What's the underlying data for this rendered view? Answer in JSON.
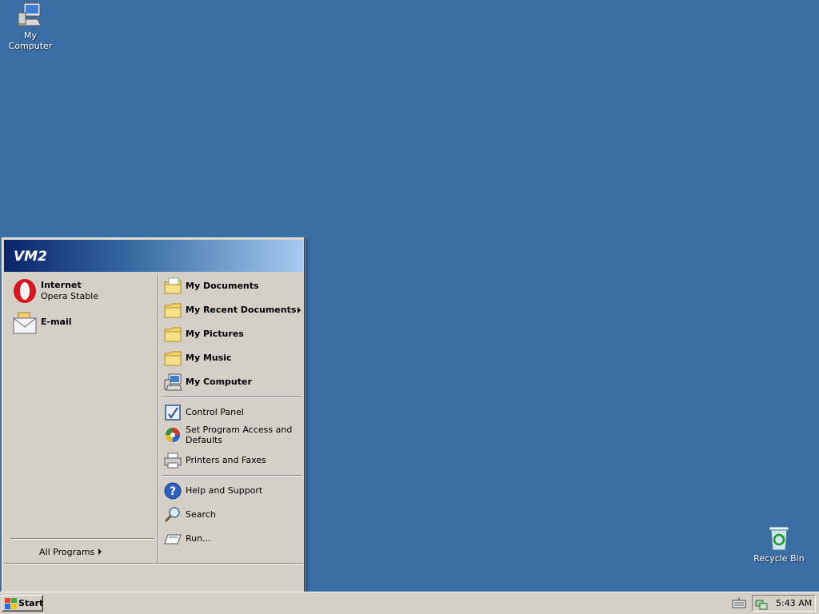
{
  "desktop": {
    "icons": [
      {
        "label": "My Computer"
      },
      {
        "label": "Recycle Bin"
      }
    ]
  },
  "start_menu": {
    "user_name": "VM2",
    "pinned": [
      {
        "title": "Internet",
        "subtitle": "Opera Stable",
        "icon": "opera-icon"
      },
      {
        "title": "E-mail",
        "icon": "email-icon"
      }
    ],
    "all_programs_label": "All Programs",
    "right_items": [
      {
        "label": "My Documents",
        "icon": "folder-documents-icon"
      },
      {
        "label": "My Recent Documents",
        "icon": "folder-icon",
        "has_submenu": true
      },
      {
        "label": "My Pictures",
        "icon": "folder-icon"
      },
      {
        "label": "My Music",
        "icon": "folder-icon"
      },
      {
        "label": "My Computer",
        "icon": "computer-icon"
      },
      {
        "label": "Control Panel",
        "icon": "control-panel-icon"
      },
      {
        "label": "Set Program Access and Defaults",
        "icon": "program-access-icon"
      },
      {
        "label": "Printers and Faxes",
        "icon": "printer-icon"
      },
      {
        "label": "Help and Support",
        "icon": "help-icon"
      },
      {
        "label": "Search",
        "icon": "search-icon"
      },
      {
        "label": "Run...",
        "icon": "run-icon"
      }
    ]
  },
  "taskbar": {
    "start_label": "Start",
    "clock": "5:43 AM"
  },
  "colors": {
    "desktop": "#3a6ea5",
    "menu_face": "#d4d0c8",
    "header_start": "#0a246a",
    "header_end": "#a6caf0"
  }
}
